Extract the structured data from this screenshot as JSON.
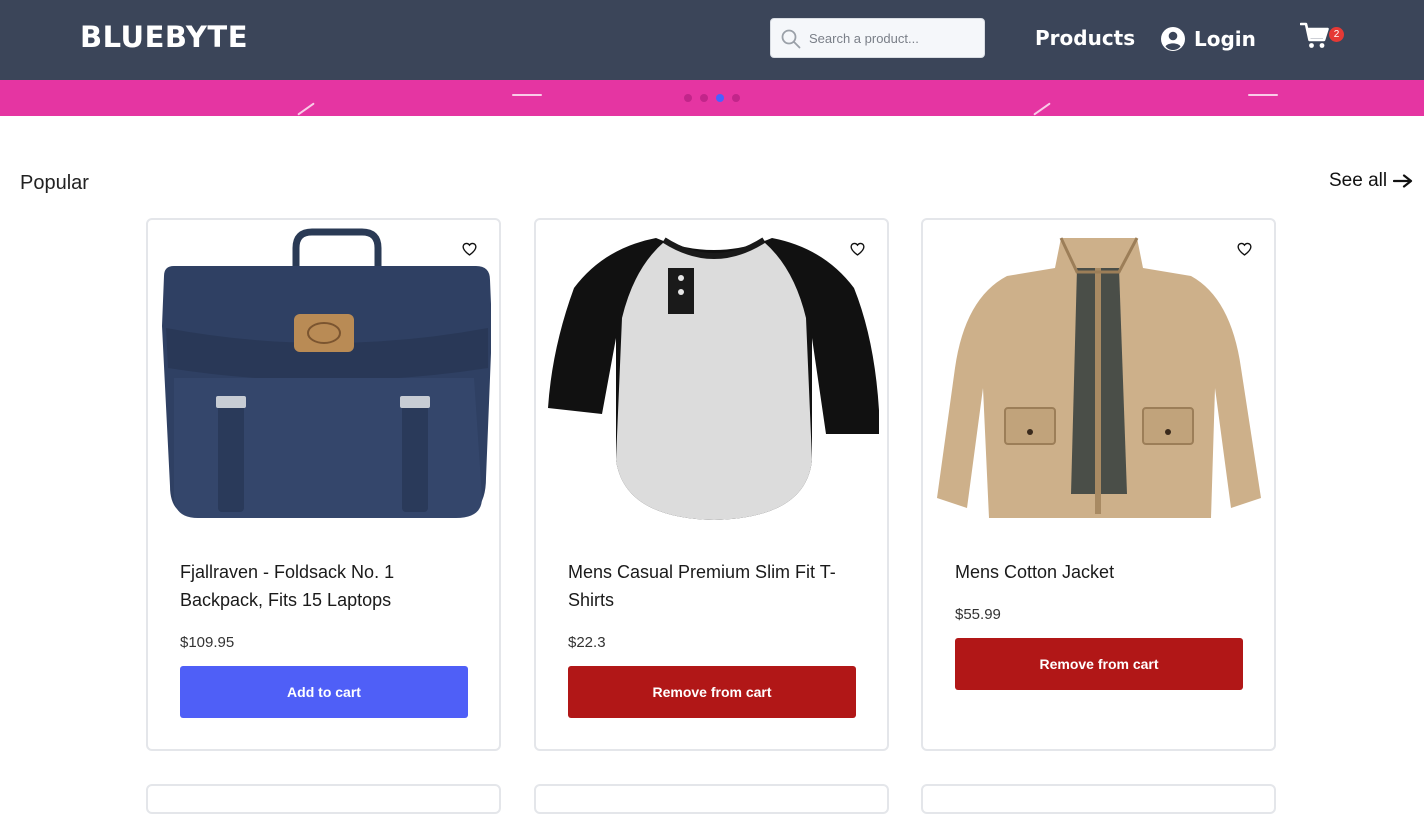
{
  "header": {
    "logo": "BLUEBYTE",
    "search_placeholder": "Search a product...",
    "nav_products": "Products",
    "nav_login": "Login",
    "cart_count": "2",
    "background_color": "#3b4559"
  },
  "banner": {
    "color": "#e535a2",
    "slides_count": 4,
    "active_slide_index": 2
  },
  "section": {
    "title": "Popular",
    "see_all": "See all"
  },
  "products": [
    {
      "title": "Fjallraven - Foldsack No. 1 Backpack, Fits 15 Laptops",
      "price": "$109.95",
      "button": "Add to cart",
      "image": "navy-backpack",
      "in_cart": false
    },
    {
      "title": "Mens Casual Premium Slim Fit T-Shirts",
      "price": "$22.3",
      "button": "Remove from cart",
      "image": "raglan-tshirt",
      "in_cart": true
    },
    {
      "title": "Mens Cotton Jacket",
      "price": "$55.99",
      "button": "Remove from cart",
      "image": "khaki-jacket",
      "in_cart": true
    }
  ],
  "colors": {
    "add_button": "#4f5ff7",
    "remove_button": "#b11717",
    "active_dot": "#4a61ff"
  }
}
